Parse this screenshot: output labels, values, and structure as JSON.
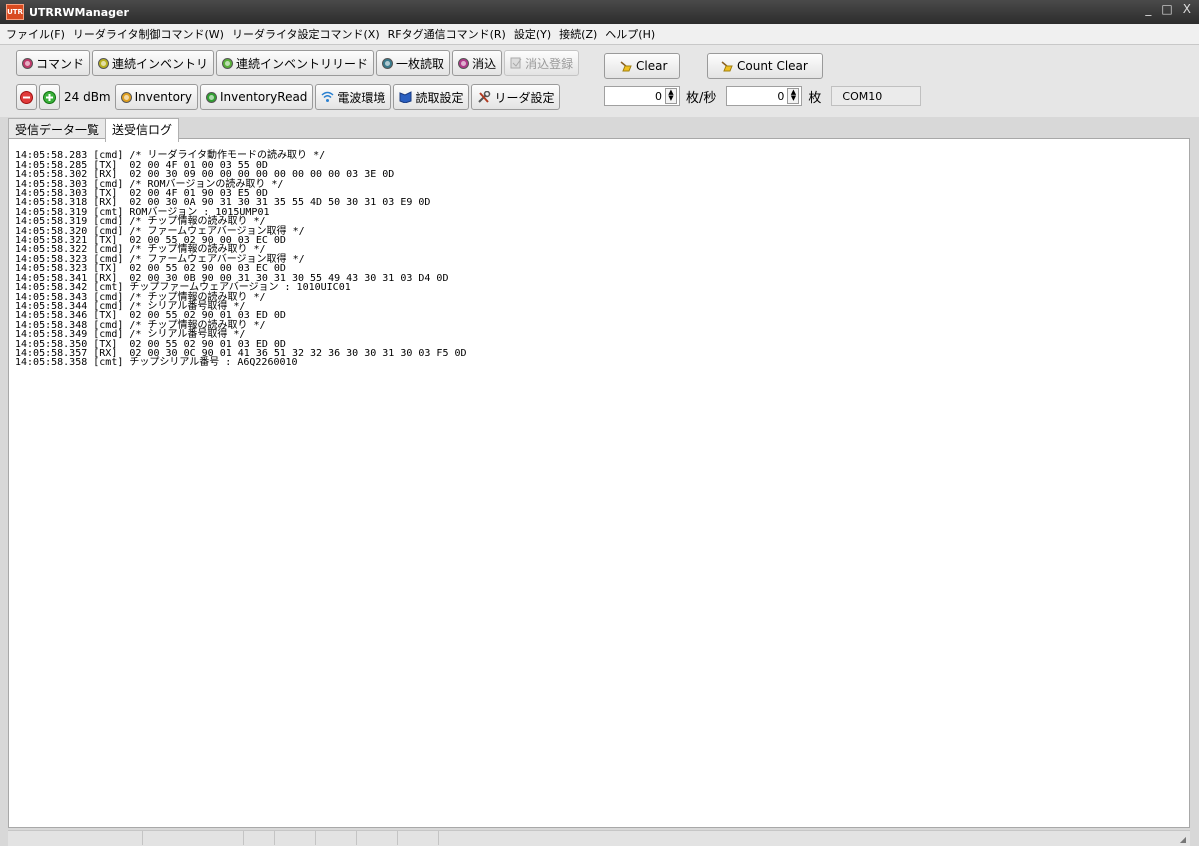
{
  "window": {
    "title": "UTRRWManager",
    "icon_text": "UTR",
    "minimize": "_",
    "maximize": "□",
    "close": "X"
  },
  "menu": [
    "ファイル(F)",
    "リーダライタ制御コマンド(W)",
    "リーダライタ設定コマンド(X)",
    "RFタグ通信コマンド(R)",
    "設定(Y)",
    "接続(Z)",
    "ヘルプ(H)"
  ],
  "toolbar1": [
    {
      "label": "コマンド",
      "icon": "command-icon",
      "dot": "#c0396a"
    },
    {
      "label": "連続インベントリ",
      "icon": "inventory-icon",
      "dot": "#b8b020"
    },
    {
      "label": "連続インベントリリード",
      "icon": "inventory-read-icon",
      "dot": "#5ab03a"
    },
    {
      "label": "一枚読取",
      "icon": "single-read-icon",
      "dot": "#3a7a8c"
    },
    {
      "label": "消込",
      "icon": "erase-icon",
      "dot": "#b03a8a"
    },
    {
      "label": "消込登録",
      "icon": "erase-register-icon",
      "disabled": true
    }
  ],
  "toolbar2": {
    "minus_icon": "minus-icon",
    "plus_icon": "plus-icon",
    "power": "24 dBm",
    "buttons": [
      {
        "label": "Inventory",
        "icon": "inventory-dot-icon",
        "dot": "#e0a020"
      },
      {
        "label": "InventoryRead",
        "icon": "inventory-read-dot-icon",
        "dot": "#30a030"
      },
      {
        "label": "電波環境",
        "icon": "wifi-icon"
      },
      {
        "label": "読取設定",
        "icon": "book-icon"
      },
      {
        "label": "リーダ設定",
        "icon": "tools-icon"
      }
    ]
  },
  "right": {
    "clear": "Clear",
    "count_clear": "Count Clear",
    "rate_value": "0",
    "rate_unit": "枚/秒",
    "count_value": "0",
    "count_unit": "枚",
    "port": "COM10"
  },
  "tabs": [
    "受信データ一覧",
    "送受信ログ"
  ],
  "active_tab": 1,
  "log": [
    "14:05:58.283 [cmd] /* リーダライタ動作モードの読み取り */",
    "14:05:58.285 [TX]  02 00 4F 01 00 03 55 0D",
    "14:05:58.302 [RX]  02 00 30 09 00 00 00 00 00 00 00 00 03 3E 0D",
    "14:05:58.303 [cmd] /* ROMバージョンの読み取り */",
    "14:05:58.303 [TX]  02 00 4F 01 90 03 E5 0D",
    "14:05:58.318 [RX]  02 00 30 0A 90 31 30 31 35 55 4D 50 30 31 03 E9 0D",
    "14:05:58.319 [cmt] ROMバージョン : 1015UMP01",
    "14:05:58.319 [cmd] /* チップ情報の読み取り */",
    "14:05:58.320 [cmd] /* ファームウェアバージョン取得 */",
    "14:05:58.321 [TX]  02 00 55 02 90 00 03 EC 0D",
    "14:05:58.322 [cmd] /* チップ情報の読み取り */",
    "14:05:58.323 [cmd] /* ファームウェアバージョン取得 */",
    "14:05:58.323 [TX]  02 00 55 02 90 00 03 EC 0D",
    "14:05:58.341 [RX]  02 00 30 0B 90 00 31 30 31 30 55 49 43 30 31 03 D4 0D",
    "14:05:58.342 [cmt] チップファームウェアバージョン : 1010UIC01",
    "14:05:58.343 [cmd] /* チップ情報の読み取り */",
    "14:05:58.344 [cmd] /* シリアル番号取得 */",
    "14:05:58.346 [TX]  02 00 55 02 90 01 03 ED 0D",
    "14:05:58.348 [cmd] /* チップ情報の読み取り */",
    "14:05:58.349 [cmd] /* シリアル番号取得 */",
    "14:05:58.350 [TX]  02 00 55 02 90 01 03 ED 0D",
    "14:05:58.357 [RX]  02 00 30 0C 90 01 41 36 51 32 32 36 30 30 31 30 03 F5 0D",
    "14:05:58.358 [cmt] チップシリアル番号 : A6Q2260010"
  ]
}
